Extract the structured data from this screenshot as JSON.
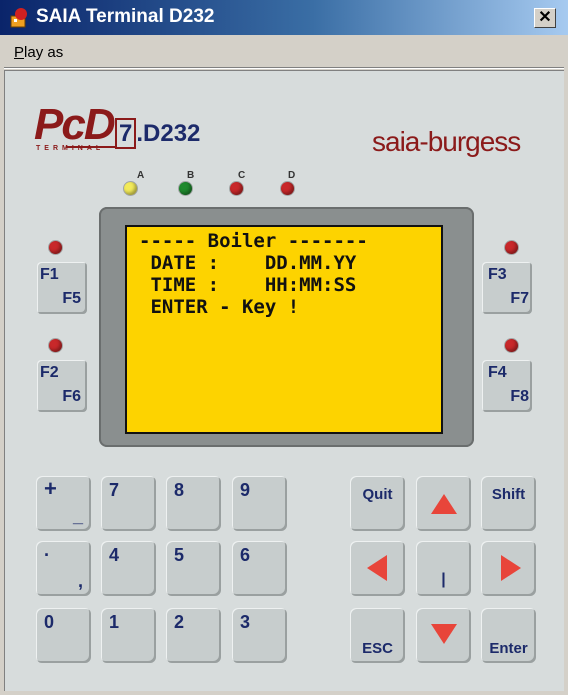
{
  "window": {
    "title": "SAIA Terminal D232",
    "close_label": "✕"
  },
  "menu": {
    "items": [
      {
        "accel": "P",
        "rest": "lay as"
      }
    ]
  },
  "branding": {
    "logo": "PcD",
    "logo_sub": "TERMINAL",
    "model_num": "7",
    "model": ".D232",
    "maker": "saia-burgess"
  },
  "leds": [
    {
      "label": "A",
      "color": "#f2ea5a"
    },
    {
      "label": "B",
      "color": "#1f8a2e"
    },
    {
      "label": "C",
      "color": "#c8282a"
    },
    {
      "label": "D",
      "color": "#c8282a"
    }
  ],
  "display": {
    "lines": [
      "----- Boiler -------",
      " DATE :    DD.MM.YY",
      " TIME :    HH:MM:SS",
      " ENTER - Key !"
    ]
  },
  "function_keys": [
    {
      "main": "F1",
      "alt": "F5"
    },
    {
      "main": "F2",
      "alt": "F6"
    },
    {
      "main": "F3",
      "alt": "F7"
    },
    {
      "main": "F4",
      "alt": "F8"
    }
  ],
  "keypad": {
    "plus": "+",
    "minus": "_",
    "k7": "7",
    "k8": "8",
    "k9": "9",
    "dot": "·",
    "comma": ",",
    "k4": "4",
    "k5": "5",
    "k6": "6",
    "k0": "0",
    "k1": "1",
    "k2": "2",
    "k3": "3",
    "quit": "Quit",
    "shift": "Shift",
    "esc": "ESC",
    "enter": "Enter",
    "center": "|"
  },
  "colors": {
    "led_red": "#c8282a",
    "arrow_red": "#e8453a",
    "lcd_bg": "#fdd300",
    "key_text": "#1c2a6a"
  }
}
